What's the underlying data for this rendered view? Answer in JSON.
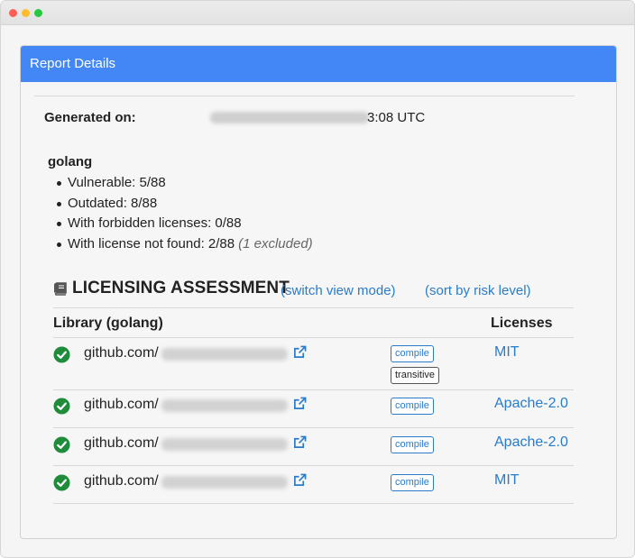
{
  "panel": {
    "title": "Report Details"
  },
  "generated": {
    "label": "Generated on:",
    "time_suffix": "3:08 UTC"
  },
  "package": {
    "name": "golang",
    "stats": [
      {
        "text": "Vulnerable: 5/88"
      },
      {
        "text": "Outdated: 8/88"
      },
      {
        "text": "With forbidden licenses: 0/88"
      },
      {
        "text": "With license not found: 2/88",
        "note": "(1 excluded)"
      }
    ]
  },
  "licensing": {
    "title": "LICENSING ASSESSMENT",
    "switch_view_link": "(switch view mode)",
    "sort_link": "(sort by risk level)",
    "col_library": "Library (golang)",
    "col_licenses": "Licenses",
    "rows": [
      {
        "library": "github.com/",
        "tags": [
          "compile",
          "transitive"
        ],
        "license": "MIT"
      },
      {
        "library": "github.com/",
        "tags": [
          "compile"
        ],
        "license": "Apache-2.0"
      },
      {
        "library": "github.com/",
        "tags": [
          "compile"
        ],
        "license": "Apache-2.0"
      },
      {
        "library": "github.com/",
        "tags": [
          "compile"
        ],
        "license": "MIT"
      }
    ]
  },
  "icons": {
    "status": "check-circle-icon",
    "external": "external-link-icon",
    "section": "book-icon"
  },
  "colors": {
    "header": "#4287f5",
    "link": "#2a7bc9",
    "check": "#1e8c3a"
  }
}
